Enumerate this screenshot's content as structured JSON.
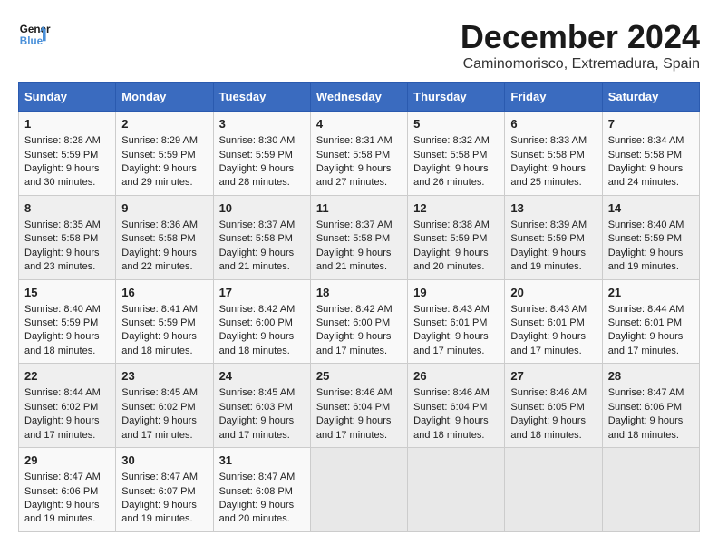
{
  "logo": {
    "line1": "General",
    "line2": "Blue"
  },
  "title": "December 2024",
  "location": "Caminomorisco, Extremadura, Spain",
  "headers": [
    "Sunday",
    "Monday",
    "Tuesday",
    "Wednesday",
    "Thursday",
    "Friday",
    "Saturday"
  ],
  "weeks": [
    [
      {
        "day": "1",
        "sunrise": "8:28 AM",
        "sunset": "5:59 PM",
        "daylight": "9 hours and 30 minutes."
      },
      {
        "day": "2",
        "sunrise": "8:29 AM",
        "sunset": "5:59 PM",
        "daylight": "9 hours and 29 minutes."
      },
      {
        "day": "3",
        "sunrise": "8:30 AM",
        "sunset": "5:59 PM",
        "daylight": "9 hours and 28 minutes."
      },
      {
        "day": "4",
        "sunrise": "8:31 AM",
        "sunset": "5:58 PM",
        "daylight": "9 hours and 27 minutes."
      },
      {
        "day": "5",
        "sunrise": "8:32 AM",
        "sunset": "5:58 PM",
        "daylight": "9 hours and 26 minutes."
      },
      {
        "day": "6",
        "sunrise": "8:33 AM",
        "sunset": "5:58 PM",
        "daylight": "9 hours and 25 minutes."
      },
      {
        "day": "7",
        "sunrise": "8:34 AM",
        "sunset": "5:58 PM",
        "daylight": "9 hours and 24 minutes."
      }
    ],
    [
      {
        "day": "8",
        "sunrise": "8:35 AM",
        "sunset": "5:58 PM",
        "daylight": "9 hours and 23 minutes."
      },
      {
        "day": "9",
        "sunrise": "8:36 AM",
        "sunset": "5:58 PM",
        "daylight": "9 hours and 22 minutes."
      },
      {
        "day": "10",
        "sunrise": "8:37 AM",
        "sunset": "5:58 PM",
        "daylight": "9 hours and 21 minutes."
      },
      {
        "day": "11",
        "sunrise": "8:37 AM",
        "sunset": "5:58 PM",
        "daylight": "9 hours and 21 minutes."
      },
      {
        "day": "12",
        "sunrise": "8:38 AM",
        "sunset": "5:59 PM",
        "daylight": "9 hours and 20 minutes."
      },
      {
        "day": "13",
        "sunrise": "8:39 AM",
        "sunset": "5:59 PM",
        "daylight": "9 hours and 19 minutes."
      },
      {
        "day": "14",
        "sunrise": "8:40 AM",
        "sunset": "5:59 PM",
        "daylight": "9 hours and 19 minutes."
      }
    ],
    [
      {
        "day": "15",
        "sunrise": "8:40 AM",
        "sunset": "5:59 PM",
        "daylight": "9 hours and 18 minutes."
      },
      {
        "day": "16",
        "sunrise": "8:41 AM",
        "sunset": "5:59 PM",
        "daylight": "9 hours and 18 minutes."
      },
      {
        "day": "17",
        "sunrise": "8:42 AM",
        "sunset": "6:00 PM",
        "daylight": "9 hours and 18 minutes."
      },
      {
        "day": "18",
        "sunrise": "8:42 AM",
        "sunset": "6:00 PM",
        "daylight": "9 hours and 17 minutes."
      },
      {
        "day": "19",
        "sunrise": "8:43 AM",
        "sunset": "6:01 PM",
        "daylight": "9 hours and 17 minutes."
      },
      {
        "day": "20",
        "sunrise": "8:43 AM",
        "sunset": "6:01 PM",
        "daylight": "9 hours and 17 minutes."
      },
      {
        "day": "21",
        "sunrise": "8:44 AM",
        "sunset": "6:01 PM",
        "daylight": "9 hours and 17 minutes."
      }
    ],
    [
      {
        "day": "22",
        "sunrise": "8:44 AM",
        "sunset": "6:02 PM",
        "daylight": "9 hours and 17 minutes."
      },
      {
        "day": "23",
        "sunrise": "8:45 AM",
        "sunset": "6:02 PM",
        "daylight": "9 hours and 17 minutes."
      },
      {
        "day": "24",
        "sunrise": "8:45 AM",
        "sunset": "6:03 PM",
        "daylight": "9 hours and 17 minutes."
      },
      {
        "day": "25",
        "sunrise": "8:46 AM",
        "sunset": "6:04 PM",
        "daylight": "9 hours and 17 minutes."
      },
      {
        "day": "26",
        "sunrise": "8:46 AM",
        "sunset": "6:04 PM",
        "daylight": "9 hours and 18 minutes."
      },
      {
        "day": "27",
        "sunrise": "8:46 AM",
        "sunset": "6:05 PM",
        "daylight": "9 hours and 18 minutes."
      },
      {
        "day": "28",
        "sunrise": "8:47 AM",
        "sunset": "6:06 PM",
        "daylight": "9 hours and 18 minutes."
      }
    ],
    [
      {
        "day": "29",
        "sunrise": "8:47 AM",
        "sunset": "6:06 PM",
        "daylight": "9 hours and 19 minutes."
      },
      {
        "day": "30",
        "sunrise": "8:47 AM",
        "sunset": "6:07 PM",
        "daylight": "9 hours and 19 minutes."
      },
      {
        "day": "31",
        "sunrise": "8:47 AM",
        "sunset": "6:08 PM",
        "daylight": "9 hours and 20 minutes."
      },
      null,
      null,
      null,
      null
    ]
  ],
  "cell_labels": {
    "sunrise": "Sunrise:",
    "sunset": "Sunset:",
    "daylight": "Daylight:"
  }
}
